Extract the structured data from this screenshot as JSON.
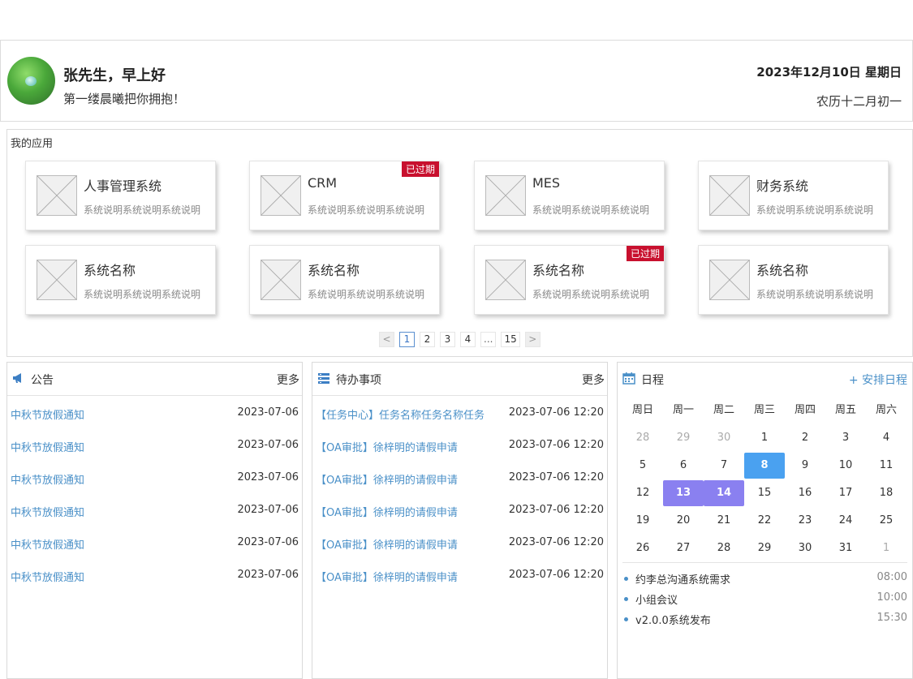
{
  "header": {
    "greeting": "张先生，早上好",
    "motto": "第一缕晨曦把你拥抱！",
    "date": "2023年12月10日  星期日",
    "lunar": "农历十二月初一"
  },
  "apps": {
    "title": "我的应用",
    "items": [
      {
        "name": "人事管理系统",
        "desc": "系统说明系统说明系统说明",
        "expired": ""
      },
      {
        "name": "CRM",
        "desc": "系统说明系统说明系统说明",
        "expired": "已过期"
      },
      {
        "name": "MES",
        "desc": "系统说明系统说明系统说明",
        "expired": ""
      },
      {
        "name": "财务系统",
        "desc": "系统说明系统说明系统说明",
        "expired": ""
      },
      {
        "name": "系统名称",
        "desc": "系统说明系统说明系统说明",
        "expired": ""
      },
      {
        "name": "系统名称",
        "desc": "系统说明系统说明系统说明",
        "expired": ""
      },
      {
        "name": "系统名称",
        "desc": "系统说明系统说明系统说明",
        "expired": "已过期"
      },
      {
        "name": "系统名称",
        "desc": "系统说明系统说明系统说明",
        "expired": ""
      }
    ],
    "pager": {
      "prev": "<",
      "next": ">",
      "pages": [
        "1",
        "2",
        "3",
        "4",
        "...",
        "15"
      ],
      "current": "1"
    }
  },
  "notice": {
    "title": "公告",
    "more": "更多",
    "icon": "megaphone-icon",
    "items": [
      {
        "title": "中秋节放假通知",
        "date": "2023-07-06"
      },
      {
        "title": "中秋节放假通知",
        "date": "2023-07-06"
      },
      {
        "title": "中秋节放假通知",
        "date": "2023-07-06"
      },
      {
        "title": "中秋节放假通知",
        "date": "2023-07-06"
      },
      {
        "title": "中秋节放假通知",
        "date": "2023-07-06"
      },
      {
        "title": "中秋节放假通知",
        "date": "2023-07-06"
      }
    ]
  },
  "todo": {
    "title": "待办事项",
    "more": "更多",
    "icon": "list-icon",
    "items": [
      {
        "title": "【任务中心】任务名称任务名称任务",
        "time": "2023-07-06 12:20"
      },
      {
        "title": "【OA审批】徐梓明的请假申请",
        "time": "2023-07-06 12:20"
      },
      {
        "title": "【OA审批】徐梓明的请假申请",
        "time": "2023-07-06 12:20"
      },
      {
        "title": "【OA审批】徐梓明的请假申请",
        "time": "2023-07-06 12:20"
      },
      {
        "title": "【OA审批】徐梓明的请假申请",
        "time": "2023-07-06 12:20"
      },
      {
        "title": "【OA审批】徐梓明的请假申请",
        "time": "2023-07-06 12:20"
      }
    ]
  },
  "calendar": {
    "title": "日程",
    "add": "+ 安排日程",
    "icon": "calendar-icon",
    "weekdays": [
      "周日",
      "周一",
      "周二",
      "周三",
      "周四",
      "周五",
      "周六"
    ],
    "days": [
      {
        "d": "28",
        "s": "gray"
      },
      {
        "d": "29",
        "s": "gray"
      },
      {
        "d": "30",
        "s": "gray"
      },
      {
        "d": "1",
        "s": ""
      },
      {
        "d": "2",
        "s": ""
      },
      {
        "d": "3",
        "s": ""
      },
      {
        "d": "4",
        "s": ""
      },
      {
        "d": "5",
        "s": ""
      },
      {
        "d": "6",
        "s": ""
      },
      {
        "d": "7",
        "s": ""
      },
      {
        "d": "8",
        "s": "today"
      },
      {
        "d": "9",
        "s": ""
      },
      {
        "d": "10",
        "s": ""
      },
      {
        "d": "11",
        "s": ""
      },
      {
        "d": "12",
        "s": ""
      },
      {
        "d": "13",
        "s": "sel"
      },
      {
        "d": "14",
        "s": "sel"
      },
      {
        "d": "15",
        "s": ""
      },
      {
        "d": "16",
        "s": ""
      },
      {
        "d": "17",
        "s": ""
      },
      {
        "d": "18",
        "s": ""
      },
      {
        "d": "19",
        "s": ""
      },
      {
        "d": "20",
        "s": ""
      },
      {
        "d": "21",
        "s": ""
      },
      {
        "d": "22",
        "s": ""
      },
      {
        "d": "23",
        "s": ""
      },
      {
        "d": "24",
        "s": ""
      },
      {
        "d": "25",
        "s": ""
      },
      {
        "d": "26",
        "s": ""
      },
      {
        "d": "27",
        "s": ""
      },
      {
        "d": "28",
        "s": ""
      },
      {
        "d": "29",
        "s": ""
      },
      {
        "d": "30",
        "s": ""
      },
      {
        "d": "31",
        "s": ""
      },
      {
        "d": "1",
        "s": "gray"
      }
    ],
    "events": [
      {
        "title": "约李总沟通系统需求",
        "time": "08:00"
      },
      {
        "title": "小组会议",
        "time": "10:00"
      },
      {
        "title": "v2.0.0系统发布",
        "time": "15:30"
      }
    ]
  },
  "colors": {
    "link": "#4a90c8",
    "expired_tag": "#c8102e",
    "today": "#4aa1f0",
    "selected": "#8a80f0"
  }
}
